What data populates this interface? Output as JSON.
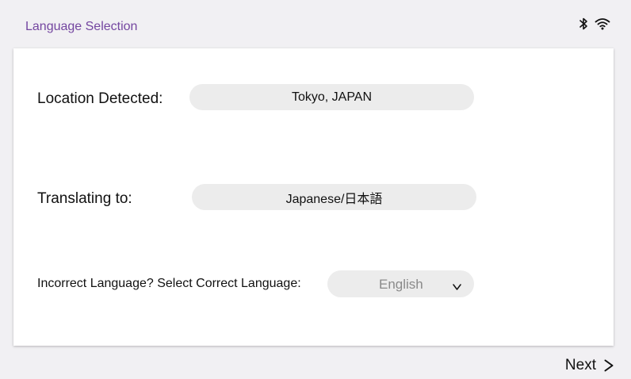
{
  "header": {
    "title": "Language Selection",
    "icons": [
      "bluetooth-icon",
      "wifi-icon"
    ]
  },
  "location": {
    "label": "Location Detected:",
    "value": "Tokyo, JAPAN"
  },
  "translating": {
    "label": "Translating to:",
    "value": "Japanese/日本語"
  },
  "correction": {
    "label": "Incorrect Language? Select Correct Language:",
    "selected": "English",
    "chevron": "chevron-down-icon"
  },
  "footer": {
    "next_label": "Next",
    "next_icon": "chevron-right-icon"
  },
  "colors": {
    "title": "#7446a0",
    "background": "#f1f0f3",
    "card": "#ffffff",
    "pill": "#ececec",
    "placeholder_text": "#8a8a8a"
  }
}
